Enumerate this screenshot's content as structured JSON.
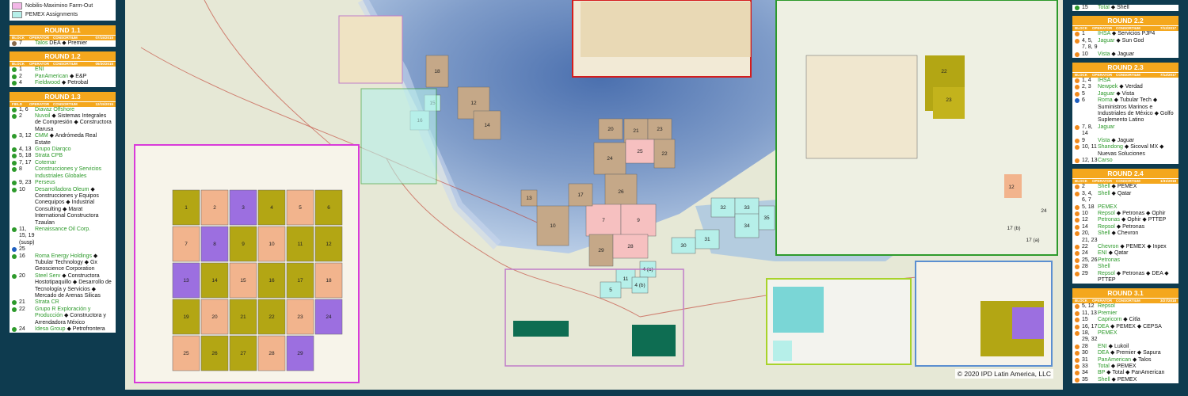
{
  "legend": {
    "items": [
      {
        "label": "Nobilis-Maximino Farm-Out",
        "color": "#f3b7e7"
      },
      {
        "label": "PEMEX Assignments",
        "color": "#b6efe9"
      }
    ]
  },
  "rounds_left": [
    {
      "title": "ROUND 1.1",
      "headers": [
        "BLOCK",
        "OPERATOR",
        "CONSORTIUM",
        "07/15/2015"
      ],
      "entries": [
        {
          "block": "7",
          "dot": "#8a6a4a",
          "operator": "Talos",
          "partners": "DEA ◆ Premier"
        }
      ]
    },
    {
      "title": "ROUND 1.2",
      "headers": [
        "BLOCK",
        "OPERATOR",
        "CONSORTIUM",
        "09/30/2015"
      ],
      "entries": [
        {
          "block": "1",
          "dot": "#2d9a2b",
          "operator": "ENI",
          "partners": ""
        },
        {
          "block": "2",
          "dot": "#2d9a2b",
          "operator": "PanAmerican",
          "partners": "◆ E&P"
        },
        {
          "block": "4",
          "dot": "#2d9a2b",
          "operator": "Fieldwood",
          "partners": "◆ Petrobal"
        }
      ]
    },
    {
      "title": "ROUND 1.3",
      "headers": [
        "FIELD",
        "OPERATOR",
        "CONSORTIUM",
        "12/15/2015"
      ],
      "entries": [
        {
          "block": "1, 6",
          "dot": "#2d9a2b",
          "operator": "Diavaz Offshore",
          "partners": ""
        },
        {
          "block": "2",
          "dot": "#2d9a2b",
          "operator": "Nuvoil",
          "partners": "◆ Sistemas Integrales de Compresión ◆ Constructora Marusa"
        },
        {
          "block": "3, 12",
          "dot": "#2d9a2b",
          "operator": "CMM",
          "partners": "◆ Andrómeda Real Estate"
        },
        {
          "block": "4, 13",
          "dot": "#2d9a2b",
          "operator": "Grupo Diarqco",
          "partners": ""
        },
        {
          "block": "5, 18",
          "dot": "#2d9a2b",
          "operator": "Strata CPB",
          "partners": ""
        },
        {
          "block": "7, 17",
          "dot": "#2d9a2b",
          "operator": "Cotemar",
          "partners": ""
        },
        {
          "block": "8",
          "dot": "#2d9a2b",
          "operator": "Construcciones y Servicios Industriales Globales",
          "partners": ""
        },
        {
          "block": "9, 23",
          "dot": "#2d9a2b",
          "operator": "Perseus",
          "partners": ""
        },
        {
          "block": "10",
          "dot": "#2d9a2b",
          "operator": "Desarrolladora Oleum",
          "partners": "◆ Construcciones y Equipos Conequipos ◆ Industrial Consulting ◆ Marat International Constructora Tzaulan"
        },
        {
          "block": "11, 15, 19 (susp)",
          "dot": "#2d9a2b",
          "operator": "Renaissance Oil Corp.",
          "partners": ""
        },
        {
          "block": "25",
          "dot": "#1f5fbf",
          "operator": "",
          "partners": ""
        },
        {
          "block": "16",
          "dot": "#2d9a2b",
          "operator": "Roma Energy Holdings",
          "partners": "◆ Tubular Technology ◆ Gx Geoscience Corporation"
        },
        {
          "block": "20",
          "dot": "#2d9a2b",
          "operator": "Steel Serv",
          "partners": "◆ Constructora Hostotipaquillo ◆ Desarrollo de Tecnología y Servicios ◆ Mercado de Arenas Silicas"
        },
        {
          "block": "21",
          "dot": "#2d9a2b",
          "operator": "Strata CR",
          "partners": ""
        },
        {
          "block": "22",
          "dot": "#2d9a2b",
          "operator": "Grupo R Exploración y Producción",
          "partners": "◆ Constructora y Arrendadora México"
        },
        {
          "block": "24",
          "dot": "#2d9a2b",
          "operator": "Idesa Group",
          "partners": "◆ Petrofrontera"
        }
      ]
    }
  ],
  "rounds_right": [
    {
      "title": "",
      "headers": [],
      "entries": [
        {
          "block": "15",
          "dot": "#2d9a2b",
          "operator": "Total",
          "partners": "◆ Shell"
        }
      ]
    },
    {
      "title": "ROUND 2.2",
      "headers": [
        "BLOCK",
        "OPERATOR",
        "CONSORTIUM",
        "7/12/2017"
      ],
      "entries": [
        {
          "block": "1",
          "dot": "#f08a1c",
          "operator": "IHSA",
          "partners": "◆ Servicios PJP4"
        },
        {
          "block": "4, 5, 7, 8, 9",
          "dot": "#f08a1c",
          "operator": "Jaguar",
          "partners": "◆ Sun God"
        },
        {
          "block": "10",
          "dot": "#f08a1c",
          "operator": "Vista",
          "partners": "◆ Jaguar"
        }
      ]
    },
    {
      "title": "ROUND 2.3",
      "headers": [
        "BLOCK",
        "OPERATOR",
        "CONSORTIUM",
        "7/12/2017"
      ],
      "entries": [
        {
          "block": "1, 4",
          "dot": "#f08a1c",
          "operator": "IHSA",
          "partners": ""
        },
        {
          "block": "2, 3",
          "dot": "#f08a1c",
          "operator": "Newpek",
          "partners": "◆ Verdad"
        },
        {
          "block": "5",
          "dot": "#f08a1c",
          "operator": "Jaguar",
          "partners": "◆ Vista"
        },
        {
          "block": "6",
          "dot": "#1f5fbf",
          "operator": "Roma",
          "partners": "◆ Tubular Tech ◆ Suministros Marinos e Industriales de México ◆ Golfo Suplemento Latino"
        },
        {
          "block": "7, 8, 14",
          "dot": "#f08a1c",
          "operator": "Jaguar",
          "partners": ""
        },
        {
          "block": "9",
          "dot": "#f08a1c",
          "operator": "Vista",
          "partners": "◆ Jaguar"
        },
        {
          "block": "10, 11",
          "dot": "#f08a1c",
          "operator": "Shandong",
          "partners": "◆ Sicoval MX ◆ Nuevas Soluciones"
        },
        {
          "block": "12, 13",
          "dot": "#f08a1c",
          "operator": "Carso",
          "partners": ""
        }
      ]
    },
    {
      "title": "ROUND 2.4",
      "headers": [
        "BLOCK",
        "OPERATOR",
        "CONSORTIUM",
        "1/31/2018"
      ],
      "entries": [
        {
          "block": "2",
          "dot": "#f08a1c",
          "operator": "Shell",
          "partners": "◆ PEMEX"
        },
        {
          "block": "3, 4, 6, 7",
          "dot": "#f08a1c",
          "operator": "Shell",
          "partners": "◆ Qatar"
        },
        {
          "block": "5, 18",
          "dot": "#f08a1c",
          "operator": "PEMEX",
          "partners": ""
        },
        {
          "block": "10",
          "dot": "#f08a1c",
          "operator": "Repsol",
          "partners": "◆ Petronas ◆ Ophir"
        },
        {
          "block": "12",
          "dot": "#f08a1c",
          "operator": "Petronas",
          "partners": "◆ Ophir ◆ PTTEP"
        },
        {
          "block": "14",
          "dot": "#f08a1c",
          "operator": "Repsol",
          "partners": "◆ Petronas"
        },
        {
          "block": "20, 21, 23",
          "dot": "#f08a1c",
          "operator": "Shell",
          "partners": "◆ Chevron"
        },
        {
          "block": "22",
          "dot": "#f08a1c",
          "operator": "Chevron",
          "partners": "◆ PEMEX ◆ Inpex"
        },
        {
          "block": "24",
          "dot": "#f08a1c",
          "operator": "ENI",
          "partners": "◆ Qatar"
        },
        {
          "block": "25, 26",
          "dot": "#f08a1c",
          "operator": "Petronas",
          "partners": ""
        },
        {
          "block": "28",
          "dot": "#f08a1c",
          "operator": "Shell",
          "partners": ""
        },
        {
          "block": "29",
          "dot": "#f08a1c",
          "operator": "Repsol",
          "partners": "◆ Petronas ◆ DEA ◆ PTTEP"
        }
      ]
    },
    {
      "title": "ROUND 3.1",
      "headers": [
        "BLOCK",
        "OPERATOR",
        "CONSORTIUM",
        "3/27/2018"
      ],
      "entries": [
        {
          "block": "5, 12",
          "dot": "#f08a1c",
          "operator": "Repsol",
          "partners": ""
        },
        {
          "block": "11, 13",
          "dot": "#f08a1c",
          "operator": "Premier",
          "partners": ""
        },
        {
          "block": "15",
          "dot": "#f08a1c",
          "operator": "Capricorn",
          "partners": "◆ Citla"
        },
        {
          "block": "16, 17",
          "dot": "#f08a1c",
          "operator": "DEA",
          "partners": "◆ PEMEX ◆ CEPSA"
        },
        {
          "block": "18, 29, 32",
          "dot": "#f08a1c",
          "operator": "PEMEX",
          "partners": ""
        },
        {
          "block": "28",
          "dot": "#f08a1c",
          "operator": "ENI",
          "partners": "◆ Lukoil"
        },
        {
          "block": "30",
          "dot": "#f08a1c",
          "operator": "DEA",
          "partners": "◆ Premier ◆ Sapura"
        },
        {
          "block": "31",
          "dot": "#f08a1c",
          "operator": "PanAmerican",
          "partners": "◆ Talos"
        },
        {
          "block": "33",
          "dot": "#f08a1c",
          "operator": "Total",
          "partners": "◆ PEMEX"
        },
        {
          "block": "34",
          "dot": "#f08a1c",
          "operator": "BP",
          "partners": "◆ Total ◆ PanAmerican"
        },
        {
          "block": "35",
          "dot": "#f08a1c",
          "operator": "Shell",
          "partners": "◆ PEMEX"
        }
      ]
    }
  ],
  "map": {
    "copyright": "© 2020 IPD Latin America, LLC",
    "deep_blocks": [
      {
        "label": "18"
      },
      {
        "label": "12"
      },
      {
        "label": "14"
      },
      {
        "label": "20"
      },
      {
        "label": "21"
      },
      {
        "label": "23"
      },
      {
        "label": "24"
      },
      {
        "label": "25"
      },
      {
        "label": "22"
      },
      {
        "label": "26"
      },
      {
        "label": "7"
      },
      {
        "label": "9"
      },
      {
        "label": "29"
      },
      {
        "label": "28"
      },
      {
        "label": "10"
      },
      {
        "label": "17"
      },
      {
        "label": "13"
      }
    ],
    "shallow_blocks": [
      {
        "label": "32"
      },
      {
        "label": "33"
      },
      {
        "label": "34"
      },
      {
        "label": "35"
      },
      {
        "label": "31"
      },
      {
        "label": "30"
      },
      {
        "label": "16"
      },
      {
        "label": "15"
      },
      {
        "label": "11"
      },
      {
        "label": "5"
      },
      {
        "label": "4 (a)"
      },
      {
        "label": "4 (b)"
      }
    ],
    "onshore_blocks": [
      {
        "label": "1"
      },
      {
        "label": "2"
      },
      {
        "label": "3"
      },
      {
        "label": "4"
      },
      {
        "label": "5"
      },
      {
        "label": "6"
      },
      {
        "label": "7"
      },
      {
        "label": "8"
      },
      {
        "label": "9"
      },
      {
        "label": "10"
      },
      {
        "label": "11"
      },
      {
        "label": "12"
      },
      {
        "label": "13"
      },
      {
        "label": "14"
      },
      {
        "label": "15"
      },
      {
        "label": "16"
      },
      {
        "label": "17"
      },
      {
        "label": "18"
      },
      {
        "label": "19"
      },
      {
        "label": "20"
      },
      {
        "label": "21"
      },
      {
        "label": "22"
      },
      {
        "label": "23"
      },
      {
        "label": "24"
      },
      {
        "label": "25"
      },
      {
        "label": "26"
      },
      {
        "label": "27"
      },
      {
        "label": "28"
      },
      {
        "label": "29"
      }
    ],
    "corner_labels": {
      "inset_right_12": "12",
      "inset_right_22": "22",
      "inset_right_23": "23",
      "inset_right_17a": "17 (a)",
      "inset_right_17b": "17 (b)",
      "inset_right_24": "24"
    }
  }
}
